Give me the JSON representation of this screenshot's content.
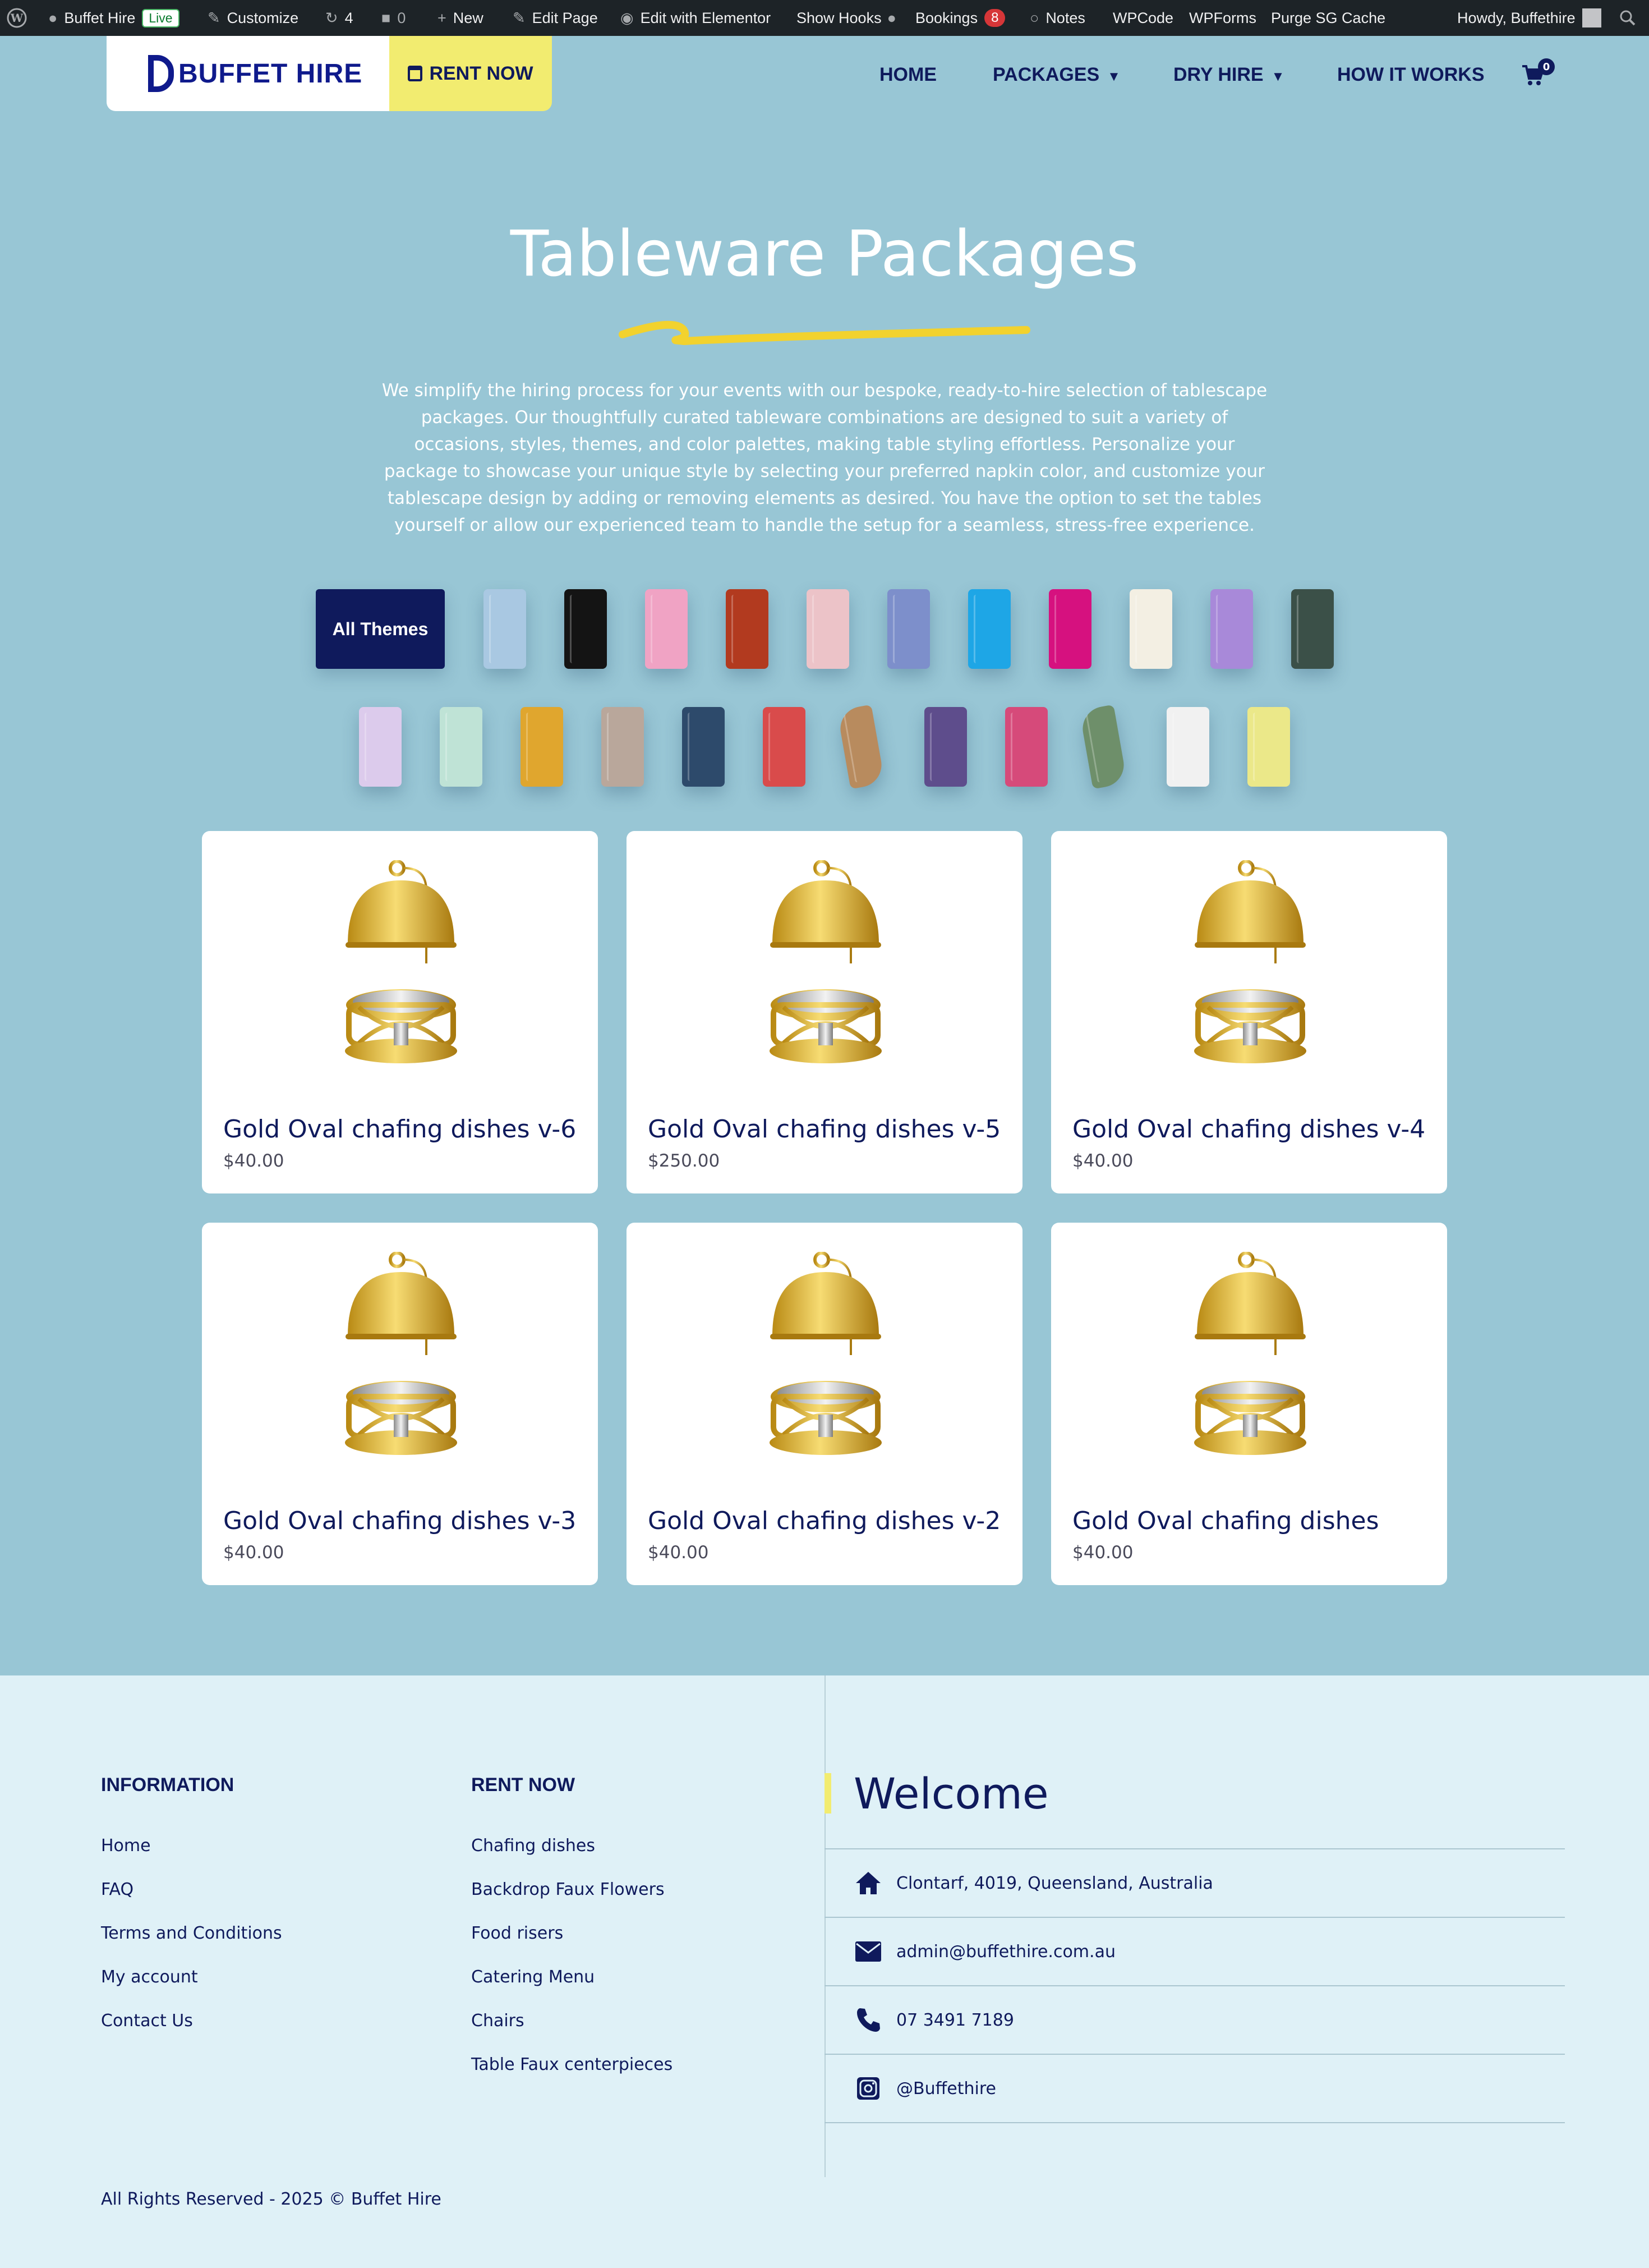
{
  "adminbar": {
    "site_name": "Buffet Hire",
    "live_badge": "Live",
    "customize": "Customize",
    "updates_count": "4",
    "comments_count": "0",
    "new": "New",
    "edit_page": "Edit Page",
    "edit_elementor": "Edit with Elementor",
    "show_hooks": "Show Hooks",
    "bookings": "Bookings",
    "bookings_count": "8",
    "notes": "Notes",
    "wpcode": "WPCode",
    "wpforms": "WPForms",
    "purge": "Purge SG Cache",
    "howdy": "Howdy, Buffethire"
  },
  "header": {
    "logo_text": "BUFFET HIRE",
    "rent_now": "RENT NOW",
    "nav": {
      "home": "HOME",
      "packages": "PACKAGES",
      "dry_hire": "DRY HIRE",
      "how_it_works": "HOW IT WORKS"
    },
    "cart_count": "0"
  },
  "hero": {
    "title": "Tableware Packages",
    "intro": "We simplify the hiring process for your events with our bespoke, ready-to-hire selection of tablescape packages. Our thoughtfully curated tableware combinations are designed to suit a variety of occasions, styles, themes, and color palettes, making table styling effortless. Personalize your package to showcase your unique style by selecting your preferred napkin color, and customize your tablescape design by adding or removing elements as desired. You have the option to set the tables yourself or allow our experienced team to handle the setup for a seamless, stress-free experience."
  },
  "filters": {
    "all_label": "All Themes",
    "swatch_colors_row1": [
      "#a9c8e2",
      "#141414",
      "#f0a3c4",
      "#b23a1f",
      "#ecc3c8",
      "#7d8fcb",
      "#1ea6e6",
      "#d6117f",
      "#f3efe3",
      "#a889d9",
      "#3b5048"
    ],
    "swatch_colors_row2": [
      "#dccbec",
      "#bfe3d6",
      "#e0a62e",
      "#b9a79b",
      "#2d4a6b",
      "#d94b4b",
      "#b88b5e",
      "#5e4d8c",
      "#d64a7a",
      "#6e8f6a",
      "#f1f1f1",
      "#ebe889"
    ]
  },
  "products": [
    {
      "title": "Gold Oval chafing dishes v-6",
      "price": "$40.00"
    },
    {
      "title": "Gold Oval chafing dishes v-5",
      "price": "$250.00"
    },
    {
      "title": "Gold Oval chafing dishes v-4",
      "price": "$40.00"
    },
    {
      "title": "Gold Oval chafing dishes v-3",
      "price": "$40.00"
    },
    {
      "title": "Gold Oval chafing dishes v-2",
      "price": "$40.00"
    },
    {
      "title": "Gold Oval chafing dishes",
      "price": "$40.00"
    }
  ],
  "footer": {
    "info_heading": "INFORMATION",
    "info_links": [
      "Home",
      "FAQ",
      "Terms and Conditions",
      "My account",
      "Contact Us"
    ],
    "rent_heading": "RENT NOW",
    "rent_links": [
      "Chafing dishes",
      "Backdrop Faux Flowers",
      "Food risers",
      "Catering Menu",
      "Chairs",
      "Table Faux centerpieces"
    ],
    "welcome": "Welcome",
    "address": "Clontarf, 4019, Queensland, Australia",
    "email": "admin@buffethire.com.au",
    "phone": "07 3491 7189",
    "instagram": "@Buffethire",
    "copyright": "All Rights Reserved - 2025 © Buffet Hire"
  },
  "colors": {
    "accent_navy": "#0f1a5c",
    "accent_yellow": "#f2ec70",
    "page_bg": "#98c6d5",
    "footer_bg": "#dff1f7"
  }
}
